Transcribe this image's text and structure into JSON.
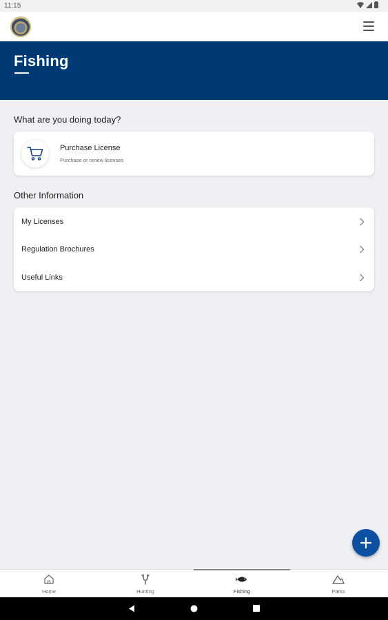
{
  "status_bar": {
    "time": "11:15"
  },
  "header": {
    "title": "Fishing"
  },
  "sections": {
    "today_title": "What are you doing today?",
    "other_title": "Other Information"
  },
  "purchase": {
    "title": "Purchase License",
    "subtitle": "Purchase or renew licenses",
    "icon": "cart-icon"
  },
  "other_items": [
    {
      "label": "My Licenses"
    },
    {
      "label": "Regulation Brochures"
    },
    {
      "label": "Useful Links"
    }
  ],
  "bottom_nav": [
    {
      "label": "Home",
      "icon": "home-icon"
    },
    {
      "label": "Hunting",
      "icon": "antler-icon"
    },
    {
      "label": "Fishing",
      "icon": "fish-icon",
      "active": true
    },
    {
      "label": "Parks",
      "icon": "mountain-icon"
    }
  ],
  "colors": {
    "header_bg": "#003a74",
    "fab_bg": "#0d4fa0",
    "page_bg": "#eef0f3"
  }
}
